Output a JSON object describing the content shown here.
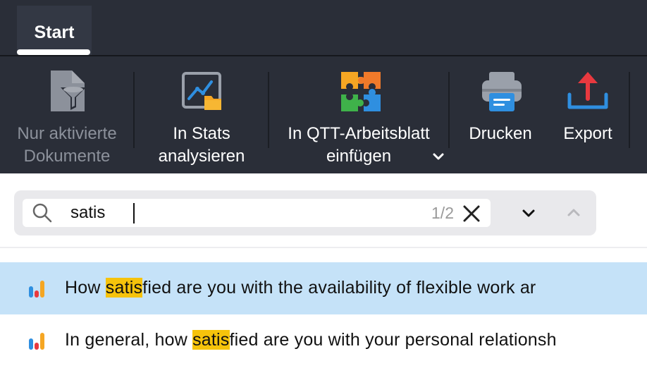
{
  "tabs": [
    {
      "label": "Start",
      "active": true
    }
  ],
  "ribbon": {
    "buttons": [
      {
        "label": "Nur aktivierte Dokumente",
        "enabled": false,
        "icon": "filter-document-icon"
      },
      {
        "label": "In Stats analysieren",
        "enabled": true,
        "icon": "stats-chart-folder-icon"
      },
      {
        "label": "In QTT-Arbeitsblatt einfügen",
        "enabled": true,
        "icon": "puzzle-icon",
        "has_dropdown": true
      },
      {
        "label": "Drucken",
        "enabled": true,
        "icon": "printer-icon"
      },
      {
        "label": "Export",
        "enabled": true,
        "icon": "export-icon"
      }
    ]
  },
  "search": {
    "value": "satis",
    "placeholder": "",
    "match_count": "1/2"
  },
  "results": [
    {
      "before": "How ",
      "match": "satis",
      "after": "fied are you with the availability of flexible work ar",
      "selected": true
    },
    {
      "before": "In general, how ",
      "match": "satis",
      "after": "fied are you with your personal relationsh",
      "selected": false
    }
  ],
  "colors": {
    "background": "#2a2e38",
    "selection": "#c5e2f8",
    "highlight": "#f6c30b"
  }
}
